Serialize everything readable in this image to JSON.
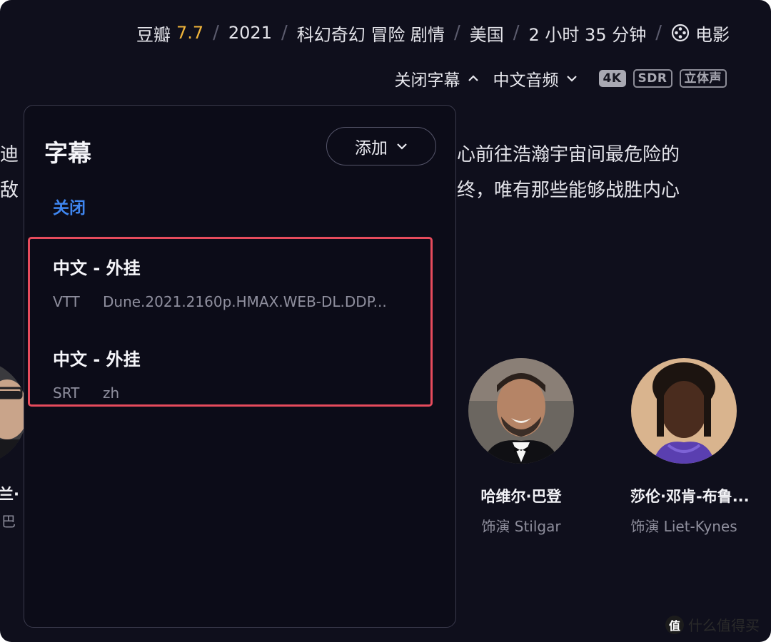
{
  "meta": {
    "douban_label": "豆瓣",
    "douban_rating": "7.7",
    "year": "2021",
    "genres": "科幻奇幻 冒险 剧情",
    "country": "美国",
    "duration": "2 小时 35 分钟",
    "type": "电影",
    "separator": "/"
  },
  "controls": {
    "subtitle_toggle": "关闭字幕",
    "audio": "中文音频",
    "badges": [
      "4K",
      "SDR",
      "立体声"
    ]
  },
  "description": {
    "line1_left": "迪",
    "line1_right": "心前往浩瀚宇宙间最危险的",
    "line2_left": "敌",
    "line2_right": "终，唯有那些能够战胜内心"
  },
  "cast": [
    {
      "name": "哈维尔·巴登",
      "role": "饰演 Stilgar"
    },
    {
      "name": "莎伦·邓肯-布鲁...",
      "role": "饰演 Liet-Kynes"
    }
  ],
  "cast_partial": {
    "name": "兰·",
    "role": "巴"
  },
  "subtitle_panel": {
    "title": "字幕",
    "add_label": "添加",
    "off_label": "关闭",
    "tracks": [
      {
        "title": "中文 - 外挂",
        "format": "VTT",
        "source": "Dune.2021.2160p.HMAX.WEB-DL.DDP..."
      },
      {
        "title": "中文 - 外挂",
        "format": "SRT",
        "source": "zh"
      }
    ]
  },
  "watermark": {
    "logo": "值",
    "text": "什么值得买"
  },
  "colors": {
    "background": "#0f0f1c",
    "rating": "#f0b43a",
    "accent_link": "#3f86f0",
    "highlight_border": "#e64b5c"
  }
}
